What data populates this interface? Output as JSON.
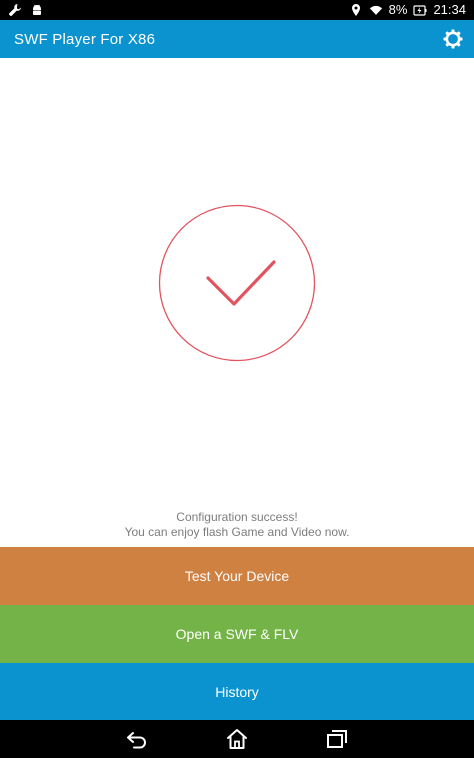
{
  "status_bar": {
    "battery_percent": "8%",
    "time": "21:34",
    "icons": [
      "wrench-icon",
      "android-debug-icon",
      "location-icon",
      "wifi-icon",
      "battery-charging-icon"
    ]
  },
  "app_bar": {
    "title": "SWF Player For X86",
    "settings_icon": "gear-icon"
  },
  "main": {
    "status_icon": "check-icon",
    "message_line1": "Configuration success!",
    "message_line2": "You can enjoy flash Game and Video now."
  },
  "buttons": {
    "test_label": "Test Your Device",
    "open_label": "Open a SWF & FLV",
    "history_label": "History"
  },
  "nav": {
    "icons": [
      "back-icon",
      "home-icon",
      "recents-icon"
    ]
  },
  "colors": {
    "app_bar": "#0a93cf",
    "check_accent": "#e05560",
    "test_button": "#cf8142",
    "open_button": "#74b347",
    "history_button": "#0a93cf"
  }
}
